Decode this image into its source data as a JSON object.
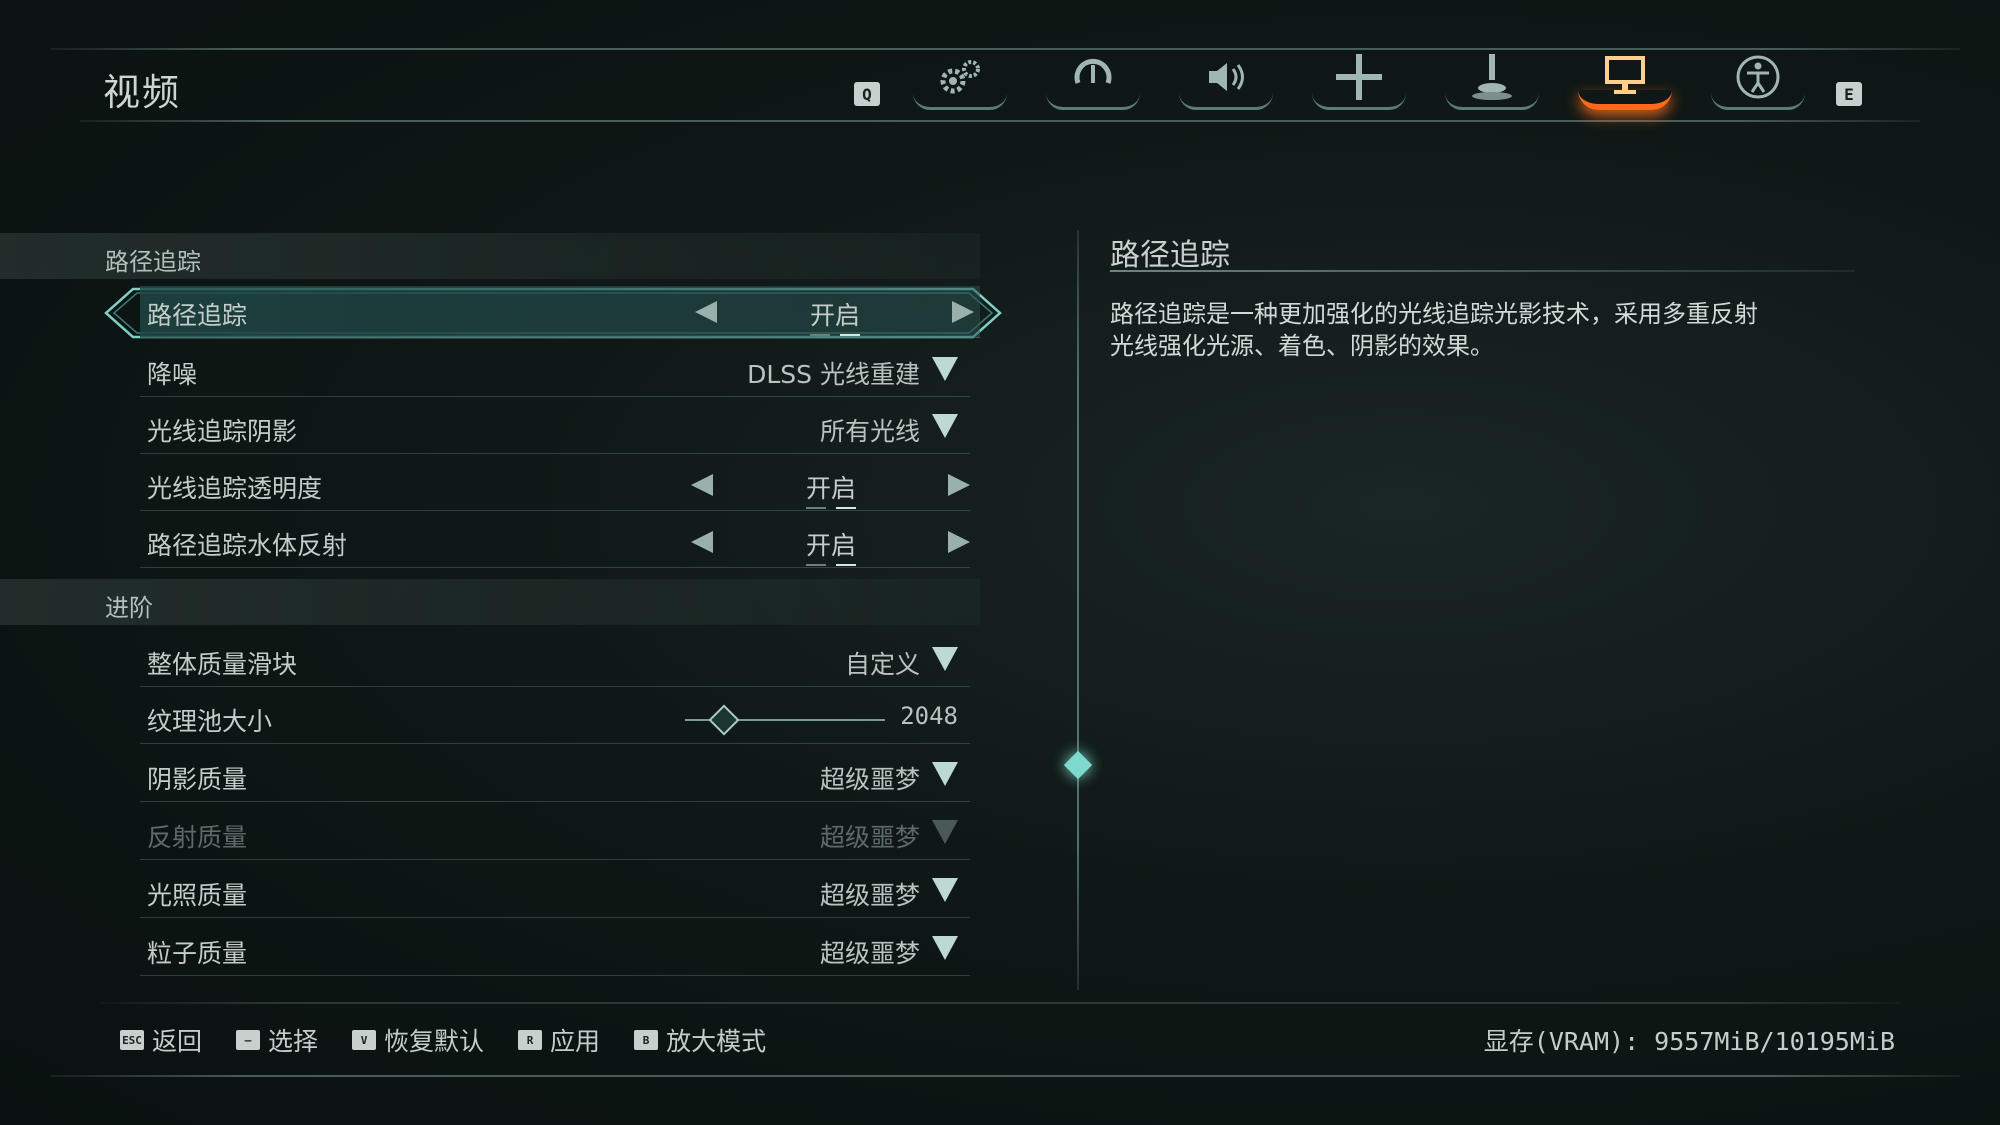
{
  "header": {
    "title": "视频",
    "key_prev": "Q",
    "key_next": "E",
    "tabs": [
      {
        "icon": "gears-icon",
        "active": false
      },
      {
        "icon": "controller-icon",
        "active": false
      },
      {
        "icon": "speaker-icon",
        "active": false
      },
      {
        "icon": "crosshair-icon",
        "active": false
      },
      {
        "icon": "joystick-icon",
        "active": false
      },
      {
        "icon": "monitor-icon",
        "active": true
      },
      {
        "icon": "accessibility-icon",
        "active": false
      }
    ],
    "active_color": "#ff6a1a"
  },
  "sections": {
    "path_tracing": {
      "title": "路径追踪",
      "rows": [
        {
          "label": "路径追踪",
          "value": "开启",
          "control": "toggle",
          "selected": true
        },
        {
          "label": "降噪",
          "value": "DLSS 光线重建",
          "control": "dropdown"
        },
        {
          "label": "光线追踪阴影",
          "value": "所有光线",
          "control": "dropdown"
        },
        {
          "label": "光线追踪透明度",
          "value": "开启",
          "control": "toggle"
        },
        {
          "label": "路径追踪水体反射",
          "value": "开启",
          "control": "toggle"
        }
      ]
    },
    "advanced": {
      "title": "进阶",
      "rows": [
        {
          "label": "整体质量滑块",
          "value": "自定义",
          "control": "dropdown"
        },
        {
          "label": "纹理池大小",
          "value": "2048",
          "control": "slider"
        },
        {
          "label": "阴影质量",
          "value": "超级噩梦",
          "control": "dropdown"
        },
        {
          "label": "反射质量",
          "value": "超级噩梦",
          "control": "dropdown",
          "disabled": true
        },
        {
          "label": "光照质量",
          "value": "超级噩梦",
          "control": "dropdown"
        },
        {
          "label": "粒子质量",
          "value": "超级噩梦",
          "control": "dropdown"
        }
      ]
    }
  },
  "description": {
    "title": "路径追踪",
    "text": "路径追踪是一种更加强化的光线追踪光影技术，采用多重反射光线强化光源、着色、阴影的效果。"
  },
  "footer": {
    "items": [
      {
        "key": "ESC",
        "label": "返回"
      },
      {
        "key": "—",
        "label": "选择"
      },
      {
        "key": "V",
        "label": "恢复默认"
      },
      {
        "key": "R",
        "label": "应用"
      },
      {
        "key": "B",
        "label": "放大模式"
      }
    ],
    "vram": "显存(VRAM): 9557MiB/10195MiB"
  }
}
